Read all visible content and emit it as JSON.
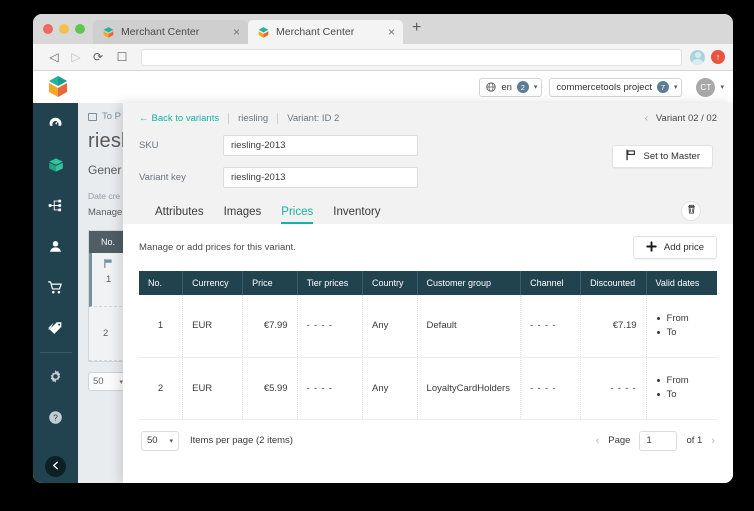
{
  "browser": {
    "tabs": [
      {
        "title": "Merchant Center",
        "close": "×",
        "favicon": "commercetools-icon"
      },
      {
        "title": "Merchant Center",
        "close": "×",
        "favicon": "commercetools-icon"
      }
    ],
    "new_tab_label": "+",
    "toolbar": {
      "back": "◁",
      "forward": "▷",
      "reload": "⟳",
      "bookmark": "☐",
      "url_value": "",
      "url_placeholder": "",
      "extension_glyph": "↑"
    }
  },
  "app": {
    "logo_name": "commercetools-logo",
    "language_selector": {
      "label": "en",
      "count": "2",
      "caret": "▾"
    },
    "project_selector": {
      "label": "commercetools project",
      "count": "7",
      "caret": "▾"
    },
    "user_menu": {
      "initials": "CT",
      "caret": "▾"
    }
  },
  "sidebar": {
    "items": [
      {
        "name": "dashboard",
        "icon": "speedometer-icon"
      },
      {
        "name": "products",
        "icon": "box-icon",
        "active": true
      },
      {
        "name": "categories",
        "icon": "tree-icon"
      },
      {
        "name": "customers",
        "icon": "person-icon"
      },
      {
        "name": "orders",
        "icon": "cart-icon"
      },
      {
        "name": "discounts",
        "icon": "tags-icon"
      }
    ],
    "bottom_items": [
      {
        "name": "settings",
        "icon": "gear-icon"
      },
      {
        "name": "support",
        "icon": "question-icon"
      }
    ],
    "collapse_icon": "chevron-left-icon"
  },
  "background_page": {
    "breadcrumb": "To P",
    "title": "riesli",
    "tab": "Gener",
    "meta_date": "Date cre",
    "meta_manage": "Manage",
    "table_header": "No.",
    "rows": [
      "1",
      "2"
    ],
    "per_page": "50",
    "caret": "▾"
  },
  "modal": {
    "back_link": "Back to variants",
    "back_arrow": "←",
    "breadcrumb_product": "riesling",
    "breadcrumb_variant": "Variant: ID 2",
    "variant_nav": {
      "prev": "‹",
      "label": "Variant 02 / 02"
    },
    "fields": [
      {
        "label": "SKU",
        "value": "riesling-2013"
      },
      {
        "label": "Variant key",
        "value": "riesling-2013"
      }
    ],
    "set_master_button": {
      "label": "Set to Master",
      "icon": "flag-icon"
    },
    "tabs": [
      {
        "label": "Attributes",
        "active": false
      },
      {
        "label": "Images",
        "active": false
      },
      {
        "label": "Prices",
        "active": true
      },
      {
        "label": "Inventory",
        "active": false
      }
    ],
    "delete_button_icon": "trash-icon",
    "description": "Manage or add prices for this variant.",
    "add_price_button": {
      "label": "Add price",
      "icon": "plus-icon"
    },
    "table": {
      "columns": [
        "No.",
        "Currency",
        "Price",
        "Tier prices",
        "Country",
        "Customer group",
        "Channel",
        "Discounted",
        "Valid dates"
      ],
      "rows": [
        {
          "no": "1",
          "currency": "EUR",
          "price": "€7.99",
          "tier_prices": "- - - -",
          "country": "Any",
          "customer_group": "Default",
          "channel": "- - - -",
          "discounted": "€7.19",
          "valid_from": "From",
          "valid_to": "To"
        },
        {
          "no": "2",
          "currency": "EUR",
          "price": "€5.99",
          "tier_prices": "- - - -",
          "country": "Any",
          "customer_group": "LoyaltyCardHolders",
          "channel": "- - - -",
          "discounted": "- - - -",
          "valid_from": "From",
          "valid_to": "To"
        }
      ]
    },
    "footer": {
      "per_page_value": "50",
      "per_page_caret": "▾",
      "items_text": "Items per page (2 items)",
      "prev": "‹",
      "page_label": "Page",
      "page_value": "1",
      "of_label": "of 1",
      "next": "›"
    }
  },
  "colors": {
    "accent_teal": "#12b3a1",
    "sidebar_dark": "#21424f",
    "badge_blue": "#5b7e96",
    "link_blue": "#4a7fa5"
  }
}
